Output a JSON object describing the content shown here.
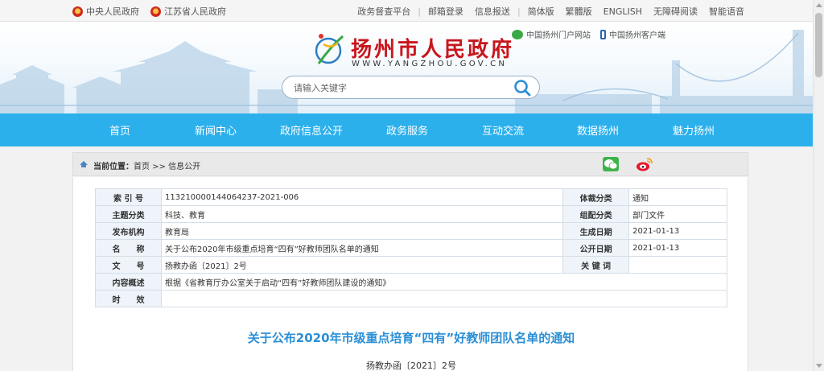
{
  "topbar": {
    "left_links": [
      {
        "label": "中央人民政府",
        "icon": "national-emblem-icon"
      },
      {
        "label": "江苏省人民政府",
        "icon": "national-emblem-icon"
      }
    ],
    "right_links": [
      "政务督查平台",
      "邮箱登录",
      "信息报送",
      "简体版",
      "繁體版",
      "ENGLISH",
      "无障碍阅读",
      "智能语音"
    ]
  },
  "header": {
    "site_name": "扬州市人民政府",
    "domain": "WWW.YANGZHOU.GOV.CN",
    "portal_links": [
      {
        "label": "中国扬州门户网站",
        "icon": "wechat-icon"
      },
      {
        "label": "中国扬州客户端",
        "icon": "mobile-phone-icon"
      }
    ],
    "search": {
      "placeholder": "请输入关键字"
    }
  },
  "nav": {
    "items": [
      "首页",
      "新闻中心",
      "政府信息公开",
      "政务服务",
      "互动交流",
      "数据扬州",
      "魅力扬州"
    ]
  },
  "breadcrumb": {
    "prefix": "当前位置：",
    "home": "首页",
    "sep": " >> ",
    "current": "信息公开"
  },
  "meta": {
    "index_no_label": "索 引 号",
    "index_no": "113210000144064237-2021-006",
    "genre_label": "体裁分类",
    "genre": "通知",
    "topic_label": "主题分类",
    "topic": "科技、教育",
    "category_label": "组配分类",
    "category": "部门文件",
    "publisher_label": "发布机构",
    "publisher": "教育局",
    "created_label": "生成日期",
    "created": "2021-01-13",
    "name_label": "名　　称",
    "name": "关于公布2020年市级重点培育“四有”好教师团队名单的通知",
    "public_label": "公开日期",
    "public": "2021-01-13",
    "docno_label": "文　　号",
    "docno": "扬教办函〔2021〕2号",
    "keywords_label": "关 键 词",
    "keywords": "",
    "summary_label": "内容概述",
    "summary": "根据《省教育厅办公室关于启动“四有”好教师团队建设的通知》",
    "validity_label": "时　　效",
    "validity": ""
  },
  "document": {
    "title": "关于公布2020年市级重点培育“四有”好教师团队名单的通知",
    "number": "扬教办函〔2021〕2号"
  },
  "colors": {
    "nav_blue": "#2cb0ec",
    "brand_red": "#c8161d",
    "title_blue": "#2b8fd6"
  }
}
